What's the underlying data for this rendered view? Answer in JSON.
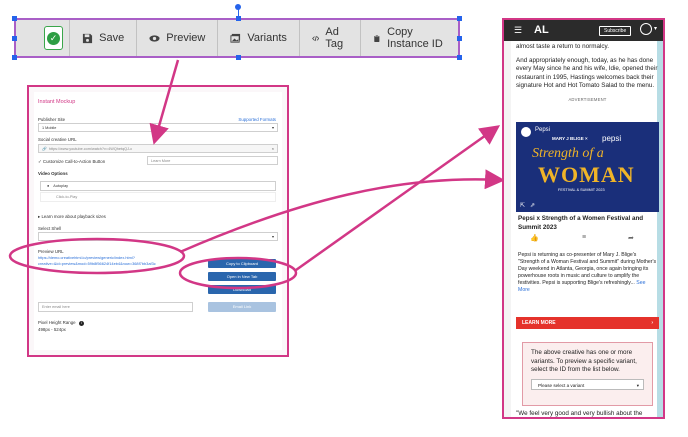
{
  "toolbar": {
    "status_icon": "check-icon",
    "buttons": [
      {
        "label": "Save",
        "icon": "save-icon"
      },
      {
        "label": "Preview",
        "icon": "eye-icon"
      },
      {
        "label": "Variants",
        "icon": "images-icon"
      },
      {
        "label": "Ad Tag",
        "icon": "code-icon"
      },
      {
        "label": "Copy Instance ID",
        "icon": "clipboard-icon"
      }
    ]
  },
  "mockup": {
    "title": "Instant Mockup",
    "publisher_site_label": "Publisher Site",
    "supported_formats": "Supported Formats",
    "publisher_site_value": "1 Mobile",
    "social_url_label": "Social creative URL",
    "social_url_value": "https://www.youtube.com/watch?v=4WQhetqQJ-c",
    "customize_cta": "Customize Call-to-Action Button",
    "cta_placeholder": "Learn More",
    "video_options_label": "Video Options",
    "autoplay": "Autoplay",
    "click_to_play": "Click-to-Play",
    "learn_more_playback": "Learn more about playback sizes",
    "select_shell_label": "Select Shell",
    "preview_url_label": "Preview URL",
    "preview_url_value": "https://demo.creativehtml.io/preview/generic/index.html?creative=&id=preview&mod=59b8f56624f14eb4&now=368f7bb3af3c",
    "copy_to_clipboard": "Copy to Clipboard",
    "open_new_tab": "Open in New Tab",
    "download": "Download",
    "email_placeholder": "Enter email here",
    "email_link": "Email Link",
    "pixel_height_label": "Pixel Height Range",
    "pixel_height_value": "498px - 524px"
  },
  "phone": {
    "logo": "AL",
    "subscribe": "Subscribe",
    "p1": "almost taste a return to normalcy.",
    "p2": "And appropriately enough, today, as he has done every May since he and his wife, Idie, opened their restaurant in 1995, Hastings welcomes back their signature Hot and Hot Tomato Salad to the menu.",
    "advertisement": "ADVERTISEMENT",
    "ad_brand": "Pepsi",
    "ad_presenter": "MARY J BLIGE ×",
    "ad_pepsi": "pepsi",
    "ad_headline_1": "Strength of a",
    "ad_headline_2": "WOMAN",
    "ad_sub": "FESTIVAL & SUMMIT 2023",
    "post_title": "Pepsi x Strength of a Women Festival and Summit 2023",
    "post_body": "Pepsi is returning as co-presenter of Mary J. Blige's \"Strength of a Woman Festival and Summit\" during Mother's Day weekend in Atlanta, Georgia, once again bringing its powerhouse roots in music and culture to amplify the festivities. Pepsi is supporting Blige's refreshingly...",
    "see_more": "See More",
    "learn_more": "LEARN MORE",
    "variant_text": "The above creative has one or more variants. To preview a specific variant, select the ID from the list below.",
    "variant_select": "Please select a variant",
    "p3": "\"We feel very good and very bullish about the remainder of the year moving forward,\" Hastings says. \"So the tomato salad is ..."
  }
}
